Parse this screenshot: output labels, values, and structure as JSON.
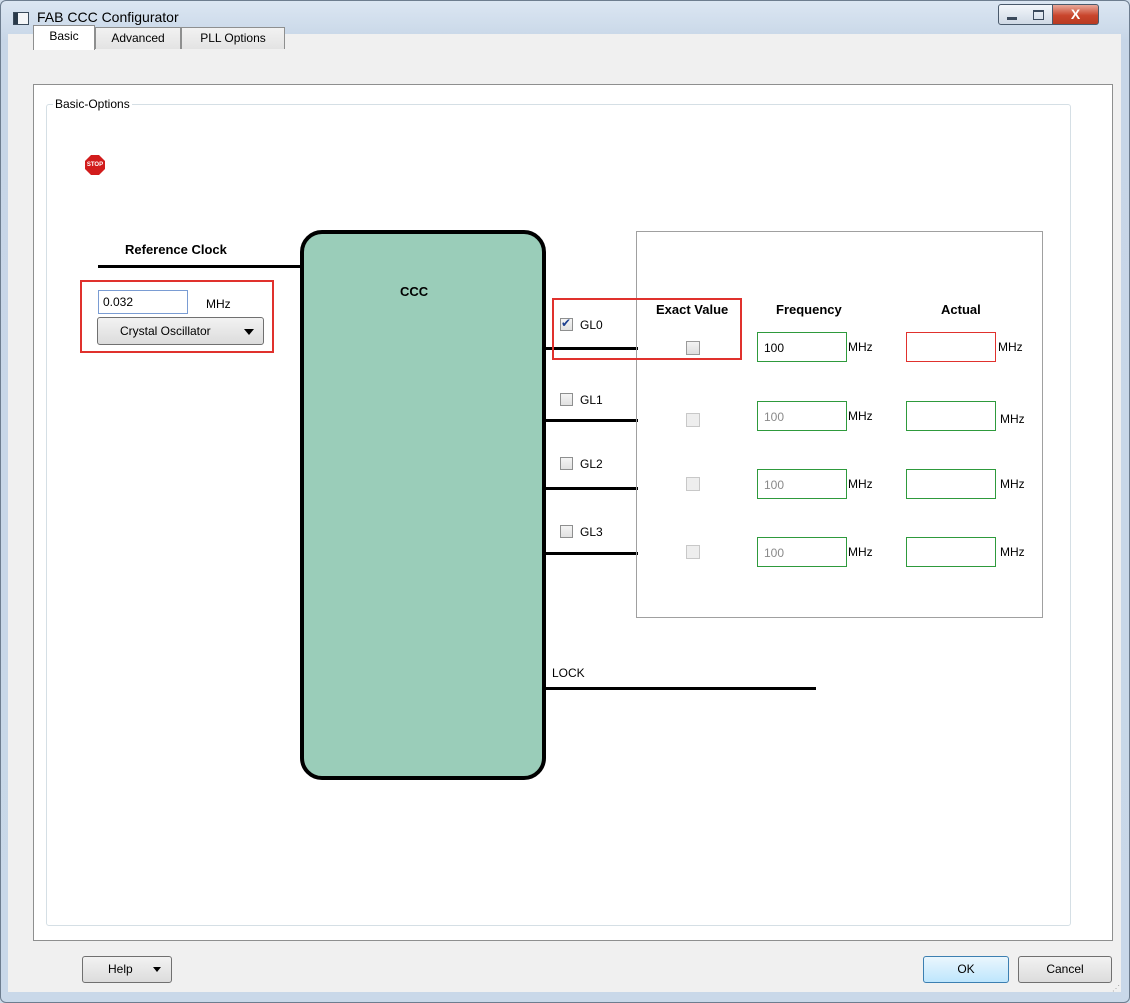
{
  "window": {
    "title": "FAB CCC Configurator",
    "close_glyph": "X"
  },
  "tabs": [
    {
      "label": "Basic",
      "active": true
    },
    {
      "label": "Advanced",
      "active": false
    },
    {
      "label": "PLL Options",
      "active": false
    }
  ],
  "group": {
    "title": "Basic-Options"
  },
  "status_icon": {
    "name": "stop-icon",
    "text": "STOP",
    "color": "#d21c1c"
  },
  "reference_clock": {
    "label": "Reference Clock",
    "value": "0.032",
    "unit": "MHz",
    "source_selected": "Crystal Oscillator"
  },
  "ccc": {
    "label": "CCC",
    "fill_color": "#9acdb9"
  },
  "outputs": {
    "headers": {
      "exact_value": "Exact Value",
      "frequency": "Frequency",
      "actual": "Actual"
    },
    "rows": [
      {
        "name": "GL0",
        "enabled": true,
        "exact_value": false,
        "frequency": "100",
        "frequency_unit": "MHz",
        "actual": "",
        "actual_unit": "MHz"
      },
      {
        "name": "GL1",
        "enabled": false,
        "exact_value": false,
        "frequency": "100",
        "frequency_unit": "MHz",
        "actual": "",
        "actual_unit": "MHz"
      },
      {
        "name": "GL2",
        "enabled": false,
        "exact_value": false,
        "frequency": "100",
        "frequency_unit": "MHz",
        "actual": "",
        "actual_unit": "MHz"
      },
      {
        "name": "GL3",
        "enabled": false,
        "exact_value": false,
        "frequency": "100",
        "frequency_unit": "MHz",
        "actual": "",
        "actual_unit": "MHz"
      }
    ],
    "lock_label": "LOCK"
  },
  "footer": {
    "help_label": "Help",
    "ok_label": "OK",
    "cancel_label": "Cancel"
  },
  "colors": {
    "error_outline": "#e0312d",
    "valid_outline": "#2e9a3c"
  }
}
